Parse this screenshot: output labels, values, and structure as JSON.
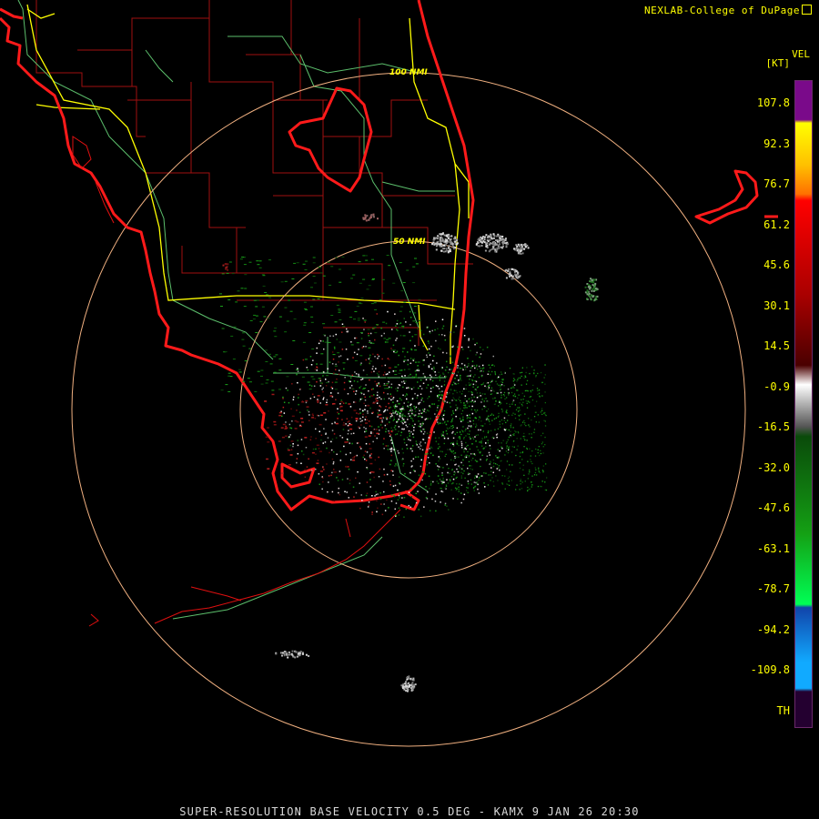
{
  "header": {
    "credit": "NEXLAB-College of DuPage"
  },
  "footer": {
    "product": "SUPER-RESOLUTION BASE VELOCITY 0.5 DEG - KAMX 9 JAN 26 20:30"
  },
  "legend": {
    "product_code": "VEL",
    "units": "[KT]",
    "ticks": [
      "107.8",
      "92.3",
      "76.7",
      "61.2",
      "45.6",
      "30.1",
      "14.5",
      "-0.9",
      "-16.5",
      "-32.0",
      "-47.6",
      "-63.1",
      "-78.7",
      "-94.2",
      "-109.8",
      "TH"
    ],
    "colors": {
      "purple": "#7a0a8a",
      "yellow": "#ffff00",
      "orange": "#ffa500",
      "red": "#ff0000",
      "dark_red": "#5a0000",
      "white": "#e8e8e8",
      "dark_green": "#0a5a0a",
      "green": "#00ff55",
      "blue": "#1155cc",
      "light_blue": "#11aaff",
      "border": "#6b2a6b"
    }
  },
  "range_rings": {
    "inner_label": "50 NMI",
    "outer_label": "100 NMI",
    "ring_color": "#f0b080"
  },
  "map_colors": {
    "coast": "#ff1a1a",
    "county": "#b01010",
    "state_line": "#60c070",
    "highway": "#ffff00"
  }
}
